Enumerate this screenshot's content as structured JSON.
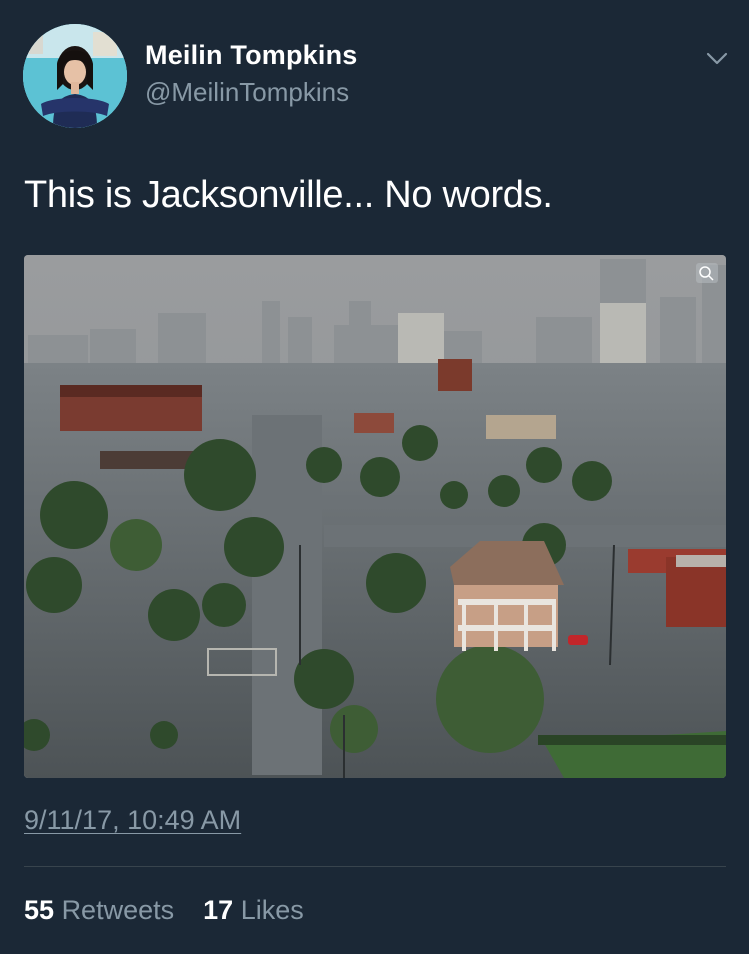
{
  "tweet": {
    "author": {
      "name": "Meilin Tompkins",
      "handle": "@MeilinTompkins"
    },
    "text": "This is Jacksonville... No words.",
    "timestamp": "9/11/17, 10:49 AM",
    "stats": {
      "retweets_count": "55",
      "retweets_label": "Retweets",
      "likes_count": "17",
      "likes_label": "Likes"
    }
  },
  "icons": {
    "menu": "chevron-down-icon",
    "zoom": "magnifier-icon"
  },
  "colors": {
    "background": "#1b2836",
    "text_primary": "#ffffff",
    "text_secondary": "#8899a6",
    "divider": "#38444d"
  }
}
